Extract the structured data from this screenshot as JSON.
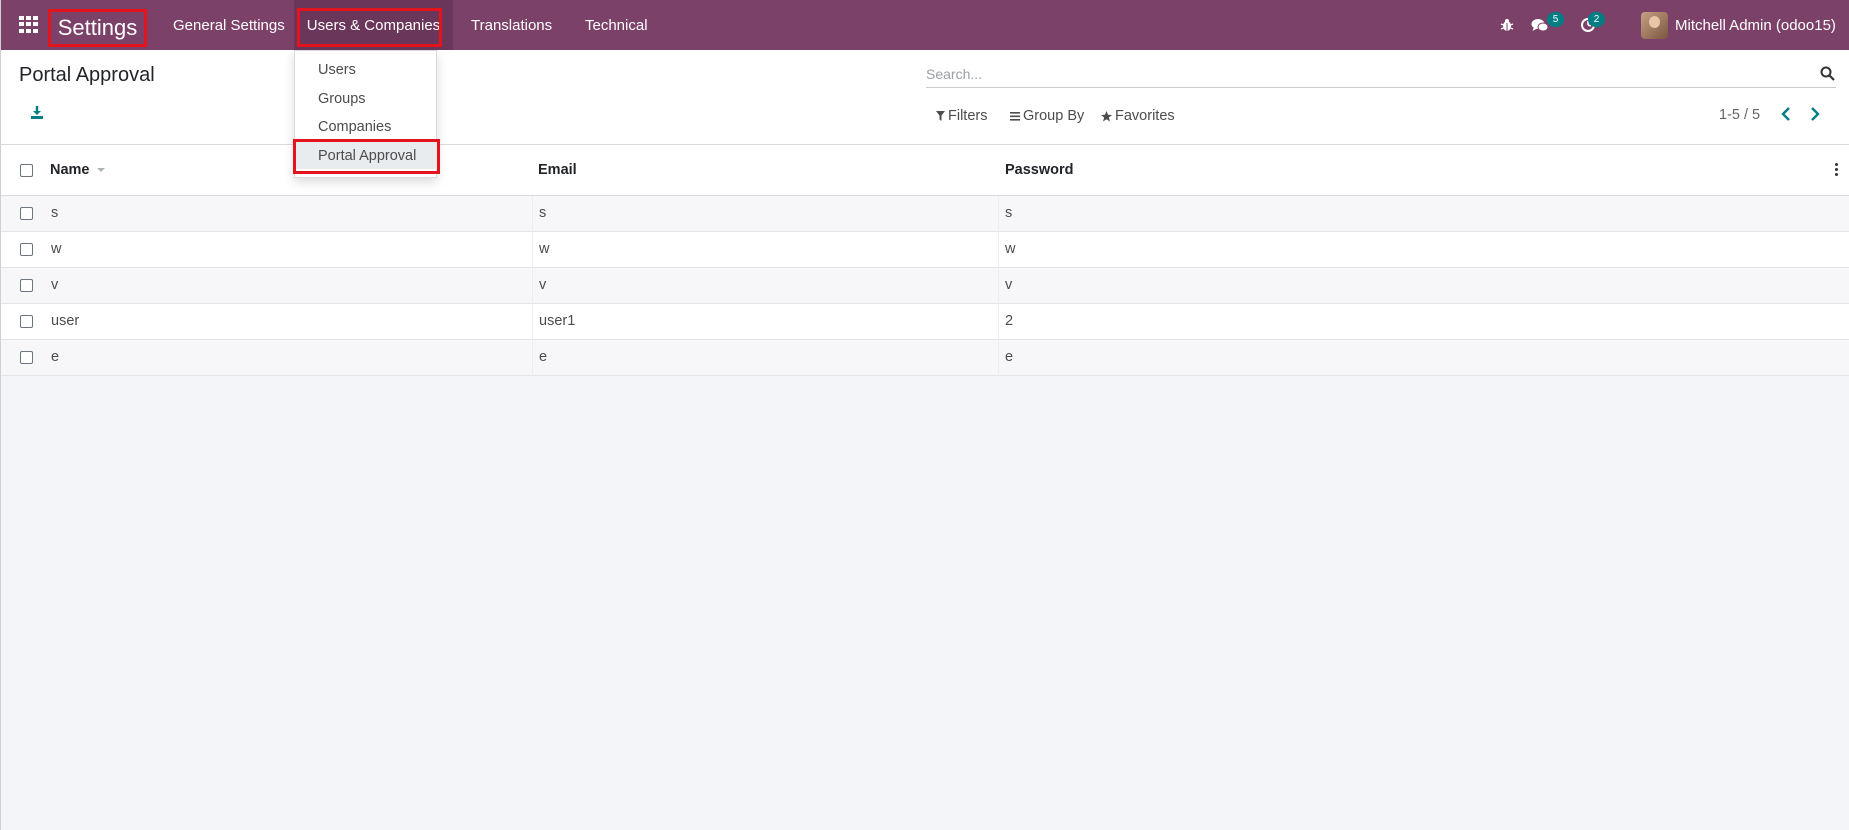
{
  "navbar": {
    "app_title": "Settings",
    "menus": {
      "general": "General Settings",
      "users_companies": "Users & Companies",
      "translations": "Translations",
      "technical": "Technical"
    },
    "messages_badge": "5",
    "activities_badge": "2",
    "user_name": "Mitchell Admin (odoo15)"
  },
  "dropdown": {
    "items": [
      "Users",
      "Groups",
      "Companies",
      "Portal Approval"
    ],
    "selected": "Portal Approval"
  },
  "control_panel": {
    "title": "Portal Approval",
    "search_placeholder": "Search...",
    "filters_label": "Filters",
    "group_by_label": "Group By",
    "favorites_label": "Favorites",
    "pager": "1-5 / 5"
  },
  "table": {
    "columns": [
      "Name",
      "Email",
      "Password"
    ],
    "rows": [
      {
        "name": "s",
        "email": "s",
        "password": "s"
      },
      {
        "name": "w",
        "email": "w",
        "password": "w"
      },
      {
        "name": "v",
        "email": "v",
        "password": "v"
      },
      {
        "name": "user",
        "email": "user1",
        "password": "2"
      },
      {
        "name": "e",
        "email": "e",
        "password": "e"
      }
    ]
  },
  "colors": {
    "navbar": "#7c4169",
    "accent": "#017e84",
    "highlight": "#e3141b"
  }
}
